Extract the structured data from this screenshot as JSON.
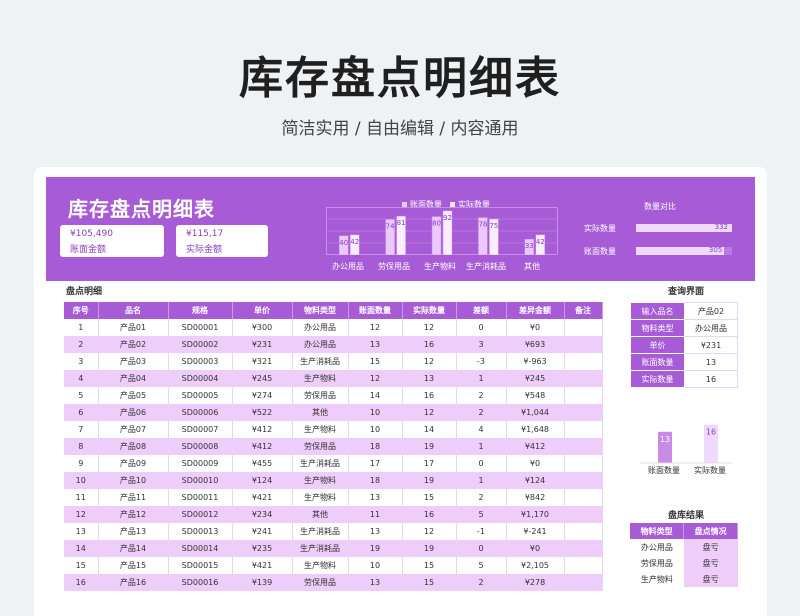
{
  "header": {
    "title": "库存盘点明细表",
    "subtitle": "简洁实用 / 自由编辑 / 内容通用"
  },
  "banner": {
    "title": "库存盘点明细表",
    "stats": [
      {
        "value": "¥105,490",
        "label": "账面金额"
      },
      {
        "value": "¥115,17",
        "label": "实际金额"
      }
    ],
    "legend": [
      "账面数量",
      "实际数量"
    ],
    "compare_title": "数量对比",
    "compare": [
      {
        "label": "实际数量",
        "value": 332
      },
      {
        "label": "账面数量",
        "value": 305
      }
    ]
  },
  "chart_data": [
    {
      "type": "bar",
      "categories": [
        "办公用品",
        "劳保用品",
        "生产物料",
        "生产消耗品",
        "其他"
      ],
      "series": [
        {
          "name": "账面数量",
          "values": [
            40,
            74,
            80,
            78,
            33
          ]
        },
        {
          "name": "实际数量",
          "values": [
            42,
            81,
            92,
            75,
            42
          ]
        }
      ],
      "legend": "top"
    },
    {
      "type": "bar",
      "categories": [
        "账面数量",
        "实际数量"
      ],
      "values": [
        13,
        16
      ]
    }
  ],
  "section_title": "盘点明细",
  "table": {
    "columns": [
      "序号",
      "品名",
      "规格",
      "单价",
      "物料类型",
      "账面数量",
      "实际数量",
      "差额",
      "差异金额",
      "备注"
    ],
    "rows": [
      [
        "1",
        "产品01",
        "SD00001",
        "¥300",
        "办公用品",
        "12",
        "12",
        "0",
        "¥0",
        ""
      ],
      [
        "2",
        "产品02",
        "SD00002",
        "¥231",
        "办公用品",
        "13",
        "16",
        "3",
        "¥693",
        ""
      ],
      [
        "3",
        "产品03",
        "SD00003",
        "¥321",
        "生产消耗品",
        "15",
        "12",
        "-3",
        "¥-963",
        ""
      ],
      [
        "4",
        "产品04",
        "SD00004",
        "¥245",
        "生产物料",
        "12",
        "13",
        "1",
        "¥245",
        ""
      ],
      [
        "5",
        "产品05",
        "SD00005",
        "¥274",
        "劳保用品",
        "14",
        "16",
        "2",
        "¥548",
        ""
      ],
      [
        "6",
        "产品06",
        "SD00006",
        "¥522",
        "其他",
        "10",
        "12",
        "2",
        "¥1,044",
        ""
      ],
      [
        "7",
        "产品07",
        "SD00007",
        "¥412",
        "生产物料",
        "10",
        "14",
        "4",
        "¥1,648",
        ""
      ],
      [
        "8",
        "产品08",
        "SD00008",
        "¥412",
        "劳保用品",
        "18",
        "19",
        "1",
        "¥412",
        ""
      ],
      [
        "9",
        "产品09",
        "SD00009",
        "¥455",
        "生产消耗品",
        "17",
        "17",
        "0",
        "¥0",
        ""
      ],
      [
        "10",
        "产品10",
        "SD00010",
        "¥124",
        "生产物料",
        "18",
        "19",
        "1",
        "¥124",
        ""
      ],
      [
        "11",
        "产品11",
        "SD00011",
        "¥421",
        "生产物料",
        "13",
        "15",
        "2",
        "¥842",
        ""
      ],
      [
        "12",
        "产品12",
        "SD00012",
        "¥234",
        "其他",
        "11",
        "16",
        "5",
        "¥1,170",
        ""
      ],
      [
        "13",
        "产品13",
        "SD00013",
        "¥241",
        "生产消耗品",
        "13",
        "12",
        "-1",
        "¥-241",
        ""
      ],
      [
        "14",
        "产品14",
        "SD00014",
        "¥235",
        "生产消耗品",
        "19",
        "19",
        "0",
        "¥0",
        ""
      ],
      [
        "15",
        "产品15",
        "SD00015",
        "¥421",
        "生产物料",
        "10",
        "15",
        "5",
        "¥2,105",
        ""
      ],
      [
        "16",
        "产品16",
        "SD00016",
        "¥139",
        "劳保用品",
        "13",
        "15",
        "2",
        "¥278",
        ""
      ]
    ]
  },
  "query": {
    "title": "查询界面",
    "rows": [
      {
        "key": "输入品名",
        "value": "产品02"
      },
      {
        "key": "物料类型",
        "value": "办公用品"
      },
      {
        "key": "单价",
        "value": "¥231"
      },
      {
        "key": "账面数量",
        "value": "13"
      },
      {
        "key": "实际数量",
        "value": "16"
      }
    ]
  },
  "result": {
    "title": "盘库结果",
    "columns": [
      "物料类型",
      "盘点情况"
    ],
    "rows": [
      [
        "办公用品",
        "盘亏"
      ],
      [
        "劳保用品",
        "盘亏"
      ],
      [
        "生产物料",
        "盘亏"
      ]
    ]
  },
  "colors": {
    "accent": "#a75bd6",
    "accent_light": "#efcdfb"
  }
}
